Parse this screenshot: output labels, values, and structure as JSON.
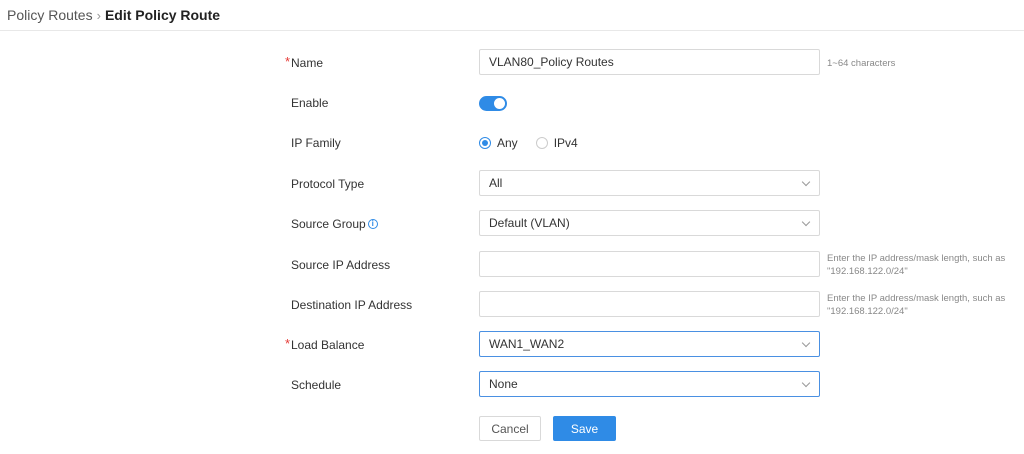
{
  "breadcrumb": {
    "parent": "Policy Routes",
    "separator": "›",
    "current": "Edit Policy Route"
  },
  "form": {
    "name": {
      "label": "Name",
      "required_mark": "*",
      "value": "VLAN80_Policy Routes",
      "hint": "1~64 characters"
    },
    "enable": {
      "label": "Enable",
      "state": "on"
    },
    "ip_family": {
      "label": "IP Family",
      "options": [
        "Any",
        "IPv4"
      ],
      "selected": "Any"
    },
    "protocol_type": {
      "label": "Protocol Type",
      "value": "All"
    },
    "source_group": {
      "label": "Source Group",
      "value": "Default (VLAN)"
    },
    "source_ip": {
      "label": "Source IP Address",
      "value": "",
      "hint_line1": "Enter the IP address/mask length, such as",
      "hint_line2": "\"192.168.122.0/24\""
    },
    "destination_ip": {
      "label": "Destination IP Address",
      "value": "",
      "hint_line1": "Enter the IP address/mask length, such as",
      "hint_line2": "\"192.168.122.0/24\""
    },
    "load_balance": {
      "label": "Load Balance",
      "required_mark": "*",
      "value": "WAN1_WAN2"
    },
    "schedule": {
      "label": "Schedule",
      "value": "None"
    }
  },
  "actions": {
    "cancel_label": "Cancel",
    "save_label": "Save"
  },
  "colors": {
    "accent": "#2f8be6",
    "required": "#e53935"
  },
  "icons": {
    "info": "info-circle-icon",
    "dropdown": "chevron-down-icon"
  }
}
